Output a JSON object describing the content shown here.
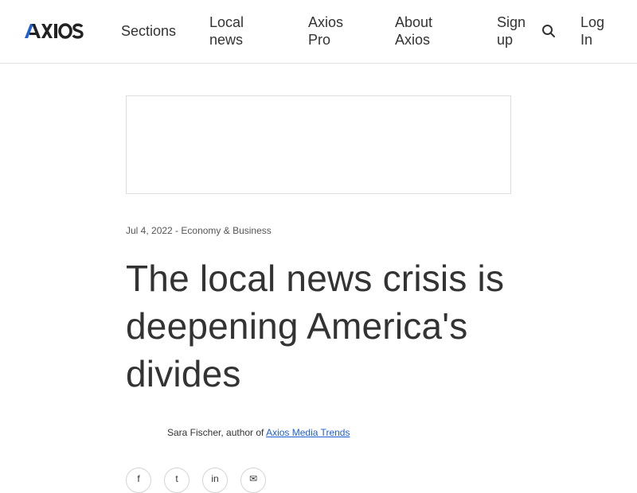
{
  "header": {
    "logo_text": "AXIOS",
    "nav": {
      "sections": "Sections",
      "local_news": "Local news",
      "axios_pro": "Axios Pro",
      "about_axios": "About Axios",
      "sign_up": "Sign up",
      "log_in": "Log In"
    }
  },
  "article": {
    "date": "Jul 4, 2022",
    "separator": " - ",
    "category": "Economy & Business",
    "headline": "The local news crisis is deepening America's divides",
    "byline_author": "Sara Fischer, author of ",
    "byline_newsletter": "Axios Media Trends"
  },
  "share": {
    "facebook": "f",
    "twitter": "t",
    "linkedin": "in",
    "email": "✉"
  },
  "colors": {
    "link": "#1f5fd6",
    "text": "#333333",
    "logo": "#222222",
    "logo_accent": "#1f5fd6"
  },
  "icons": {
    "search": "search-icon",
    "share_facebook": "facebook-icon",
    "share_twitter": "twitter-icon",
    "share_linkedin": "linkedin-icon",
    "share_email": "email-icon"
  }
}
